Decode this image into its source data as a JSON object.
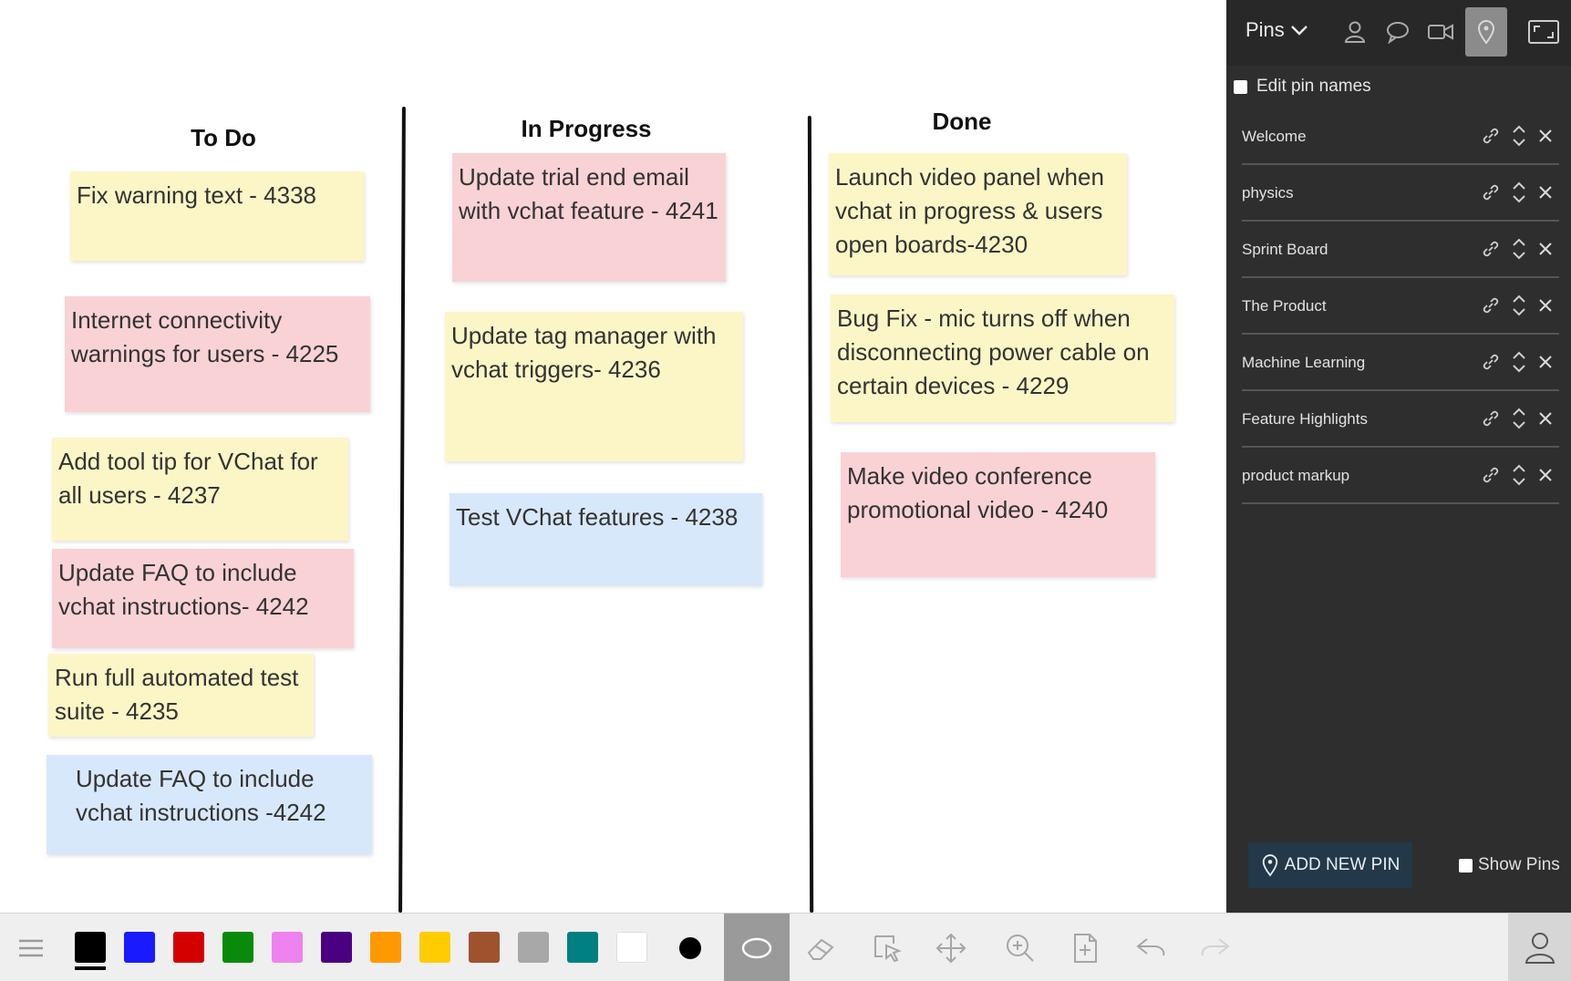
{
  "board": {
    "columns": [
      {
        "title": "To Do"
      },
      {
        "title": "In Progress"
      },
      {
        "title": "Done"
      }
    ],
    "notes": [
      {
        "text": "Fix warning text - 4338",
        "color": "yellow"
      },
      {
        "text": "Internet connectivity warnings for users -  4225",
        "color": "pink"
      },
      {
        "text": "Add tool tip for VChat for all users - 4237",
        "color": "yellow"
      },
      {
        "text": "Update FAQ to include vchat instructions- 4242",
        "color": "pink"
      },
      {
        "text": "Run full automated test suite - 4235",
        "color": "yellow"
      },
      {
        "text": "Update FAQ to include vchat instructions -4242",
        "color": "blue"
      },
      {
        "text": "Update trial end email with vchat feature - 4241",
        "color": "pink"
      },
      {
        "text": "Update tag manager with vchat triggers- 4236",
        "color": "yellow"
      },
      {
        "text": "Test VChat features - 4238",
        "color": "blue"
      },
      {
        "text": "Launch video panel when vchat in progress & users open boards-4230",
        "color": "yellow"
      },
      {
        "text": "Bug Fix - mic turns off when disconnecting power cable on certain devices - 4229",
        "color": "yellow"
      },
      {
        "text": "Make video conference promotional video - 4240",
        "color": "pink"
      }
    ]
  },
  "panel": {
    "dropdown_label": "Pins",
    "edit_pin_names_label": "Edit pin names",
    "pins": [
      {
        "name": "Welcome"
      },
      {
        "name": "physics"
      },
      {
        "name": "Sprint Board"
      },
      {
        "name": "The Product"
      },
      {
        "name": "Machine Learning"
      },
      {
        "name": "Feature Highlights"
      },
      {
        "name": "product markup"
      }
    ],
    "add_pin_label": "ADD NEW PIN",
    "show_pins_label": "Show Pins"
  },
  "toolbar": {
    "colors": [
      "#000000",
      "#1a1aff",
      "#d40000",
      "#0a8a0a",
      "#ee82ee",
      "#4b0082",
      "#ff9900",
      "#ffcc00",
      "#a0522d",
      "#a8a8a8",
      "#008080",
      "#ffffff"
    ],
    "selected_color": "#000000",
    "icons": [
      "menu-icon",
      "brush-dot-icon",
      "ellipse-icon",
      "eraser-icon",
      "select-icon",
      "move-icon",
      "zoom-in-icon",
      "add-page-icon",
      "undo-icon",
      "redo-icon",
      "user-icon"
    ]
  }
}
